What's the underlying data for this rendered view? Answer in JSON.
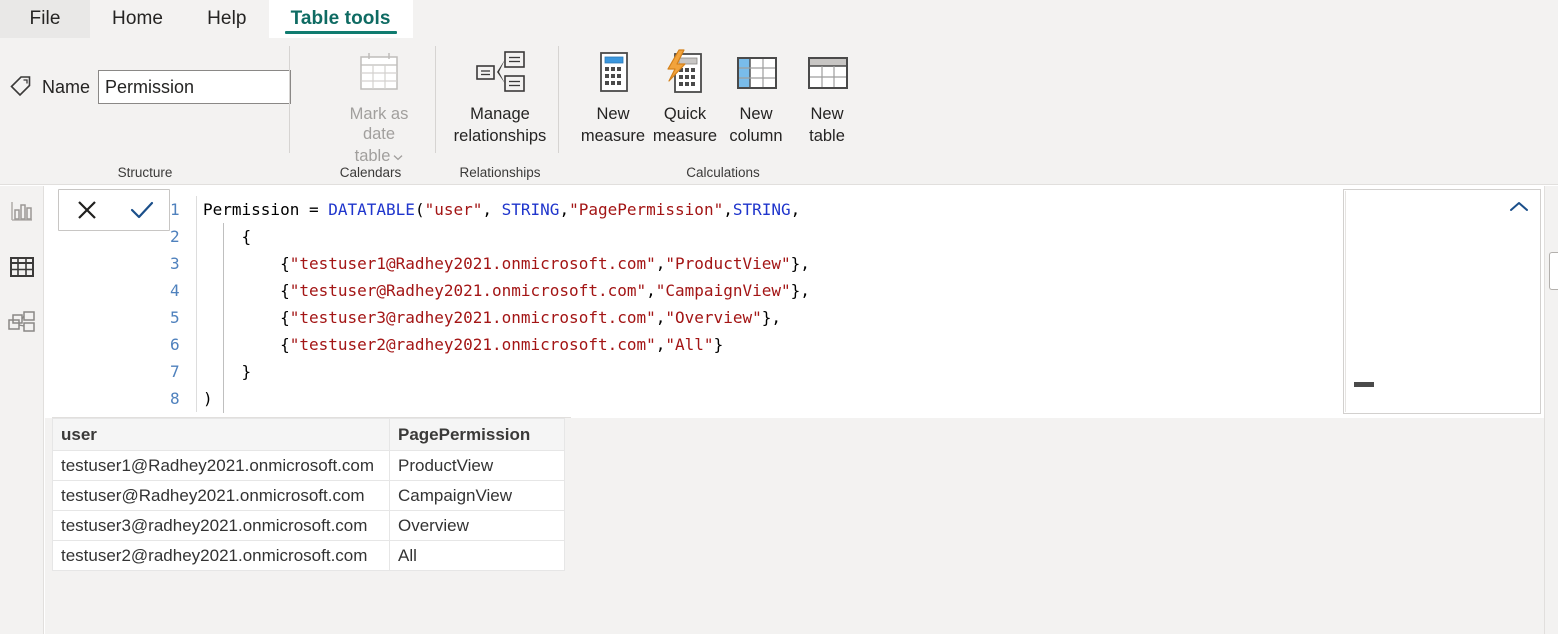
{
  "window": {
    "app": "Power BI Desktop",
    "view": "Data view"
  },
  "ribbon": {
    "tabs": [
      {
        "label": "File",
        "active": false,
        "kind": "file"
      },
      {
        "label": "Home",
        "active": false,
        "kind": "normal"
      },
      {
        "label": "Help",
        "active": false,
        "kind": "normal"
      },
      {
        "label": "Table tools",
        "active": true,
        "kind": "normal"
      }
    ],
    "accent_color": "#107c70",
    "active_tab_text_color": "#0f6b63",
    "groups": [
      {
        "key": "structure",
        "label": "Structure"
      },
      {
        "key": "calendars",
        "label": "Calendars"
      },
      {
        "key": "relationships",
        "label": "Relationships"
      },
      {
        "key": "calculations",
        "label": "Calculations"
      }
    ],
    "structure": {
      "name_label": "Name",
      "name_value": "Permission",
      "name_placeholder": "Table name",
      "tag_icon": "tag-icon"
    },
    "calendars": {
      "mark_as_date_table": {
        "line1": "Mark as date",
        "line2": "table",
        "disabled": true,
        "icon": "calendar-icon",
        "has_dropdown": true
      }
    },
    "relationships": {
      "manage_relationships": {
        "line1": "Manage",
        "line2": "relationships",
        "icon": "relationships-icon"
      }
    },
    "calculations": {
      "buttons": [
        {
          "line1": "New",
          "line2": "measure",
          "icon": "new-measure-calculator-icon"
        },
        {
          "line1": "Quick",
          "line2": "measure",
          "icon": "quick-measure-lightning-calculator-icon"
        },
        {
          "line1": "New",
          "line2": "column",
          "icon": "new-column-table-icon"
        },
        {
          "line1": "New",
          "line2": "table",
          "icon": "new-table-icon"
        }
      ]
    }
  },
  "rail": {
    "items": [
      {
        "name": "report-view",
        "icon": "bar-chart-icon",
        "active": false
      },
      {
        "name": "data-view",
        "icon": "table-grid-icon",
        "active": true
      },
      {
        "name": "model-view",
        "icon": "model-relationships-icon",
        "active": false
      }
    ]
  },
  "formula_bar": {
    "cancel_icon": "close-x-icon",
    "commit_icon": "checkmark-icon",
    "collapse_icon": "chevron-up-icon",
    "line_numbers": [
      "1",
      "2",
      "3",
      "4",
      "5",
      "6",
      "7",
      "8"
    ],
    "lines": [
      [
        {
          "t": "Permission = ",
          "c": "plain"
        },
        {
          "t": "DATATABLE",
          "c": "fn"
        },
        {
          "t": "(",
          "c": "plain"
        },
        {
          "t": "\"user\"",
          "c": "str"
        },
        {
          "t": ", ",
          "c": "plain"
        },
        {
          "t": "STRING",
          "c": "kw"
        },
        {
          "t": ",",
          "c": "plain"
        },
        {
          "t": "\"PagePermission\"",
          "c": "str"
        },
        {
          "t": ",",
          "c": "plain"
        },
        {
          "t": "STRING",
          "c": "kw"
        },
        {
          "t": ",",
          "c": "plain"
        }
      ],
      [
        {
          "t": "    {",
          "c": "plain"
        }
      ],
      [
        {
          "t": "        {",
          "c": "plain"
        },
        {
          "t": "\"testuser1@Radhey2021.onmicrosoft.com\"",
          "c": "str"
        },
        {
          "t": ",",
          "c": "plain"
        },
        {
          "t": "\"ProductView\"",
          "c": "str"
        },
        {
          "t": "},",
          "c": "plain"
        }
      ],
      [
        {
          "t": "        {",
          "c": "plain"
        },
        {
          "t": "\"testuser@Radhey2021.onmicrosoft.com\"",
          "c": "str"
        },
        {
          "t": ",",
          "c": "plain"
        },
        {
          "t": "\"CampaignView\"",
          "c": "str"
        },
        {
          "t": "},",
          "c": "plain"
        }
      ],
      [
        {
          "t": "        {",
          "c": "plain"
        },
        {
          "t": "\"testuser3@radhey2021.onmicrosoft.com\"",
          "c": "str"
        },
        {
          "t": ",",
          "c": "plain"
        },
        {
          "t": "\"Overview\"",
          "c": "str"
        },
        {
          "t": "},",
          "c": "plain"
        }
      ],
      [
        {
          "t": "        {",
          "c": "plain"
        },
        {
          "t": "\"testuser2@radhey2021.onmicrosoft.com\"",
          "c": "str"
        },
        {
          "t": ",",
          "c": "plain"
        },
        {
          "t": "\"All\"",
          "c": "str"
        },
        {
          "t": "}",
          "c": "plain"
        }
      ],
      [
        {
          "t": "    }",
          "c": "plain"
        }
      ],
      [
        {
          "t": ")",
          "c": "plain"
        }
      ]
    ],
    "syntax_colors": {
      "function": "#1f35cc",
      "keyword": "#1f35cc",
      "string": "#a31515",
      "plain": "#000000",
      "line_number": "#4f81bd"
    }
  },
  "data_grid": {
    "columns": [
      "user",
      "PagePermission"
    ],
    "rows": [
      [
        "testuser1@Radhey2021.onmicrosoft.com",
        "ProductView"
      ],
      [
        "testuser@Radhey2021.onmicrosoft.com",
        "CampaignView"
      ],
      [
        "testuser3@radhey2021.onmicrosoft.com",
        "Overview"
      ],
      [
        "testuser2@radhey2021.onmicrosoft.com",
        "All"
      ]
    ]
  }
}
